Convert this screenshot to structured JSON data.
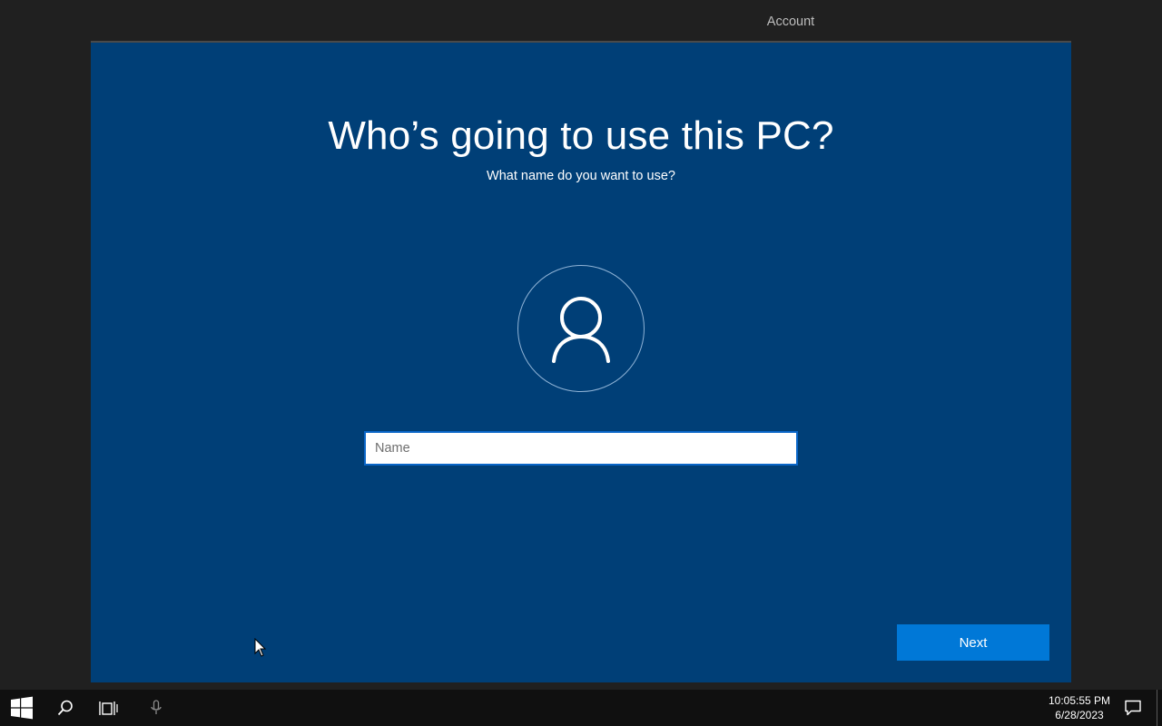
{
  "header": {
    "step_label": "Account"
  },
  "main": {
    "title": "Who’s going to use this PC?",
    "subtitle": "What name do you want to use?",
    "name_field": {
      "placeholder": "Name",
      "value": ""
    },
    "next_label": "Next",
    "avatar_icon": "user-icon"
  },
  "taskbar": {
    "icons": [
      "windows-start-icon",
      "search-icon",
      "task-view-icon",
      "microphone-icon",
      "action-center-icon"
    ],
    "time": "10:05:55 PM",
    "date": "6/28/2023"
  },
  "colors": {
    "panel_background": "#003f77",
    "accent": "#0078d7",
    "page_background": "#202020",
    "taskbar_background": "#101010"
  }
}
